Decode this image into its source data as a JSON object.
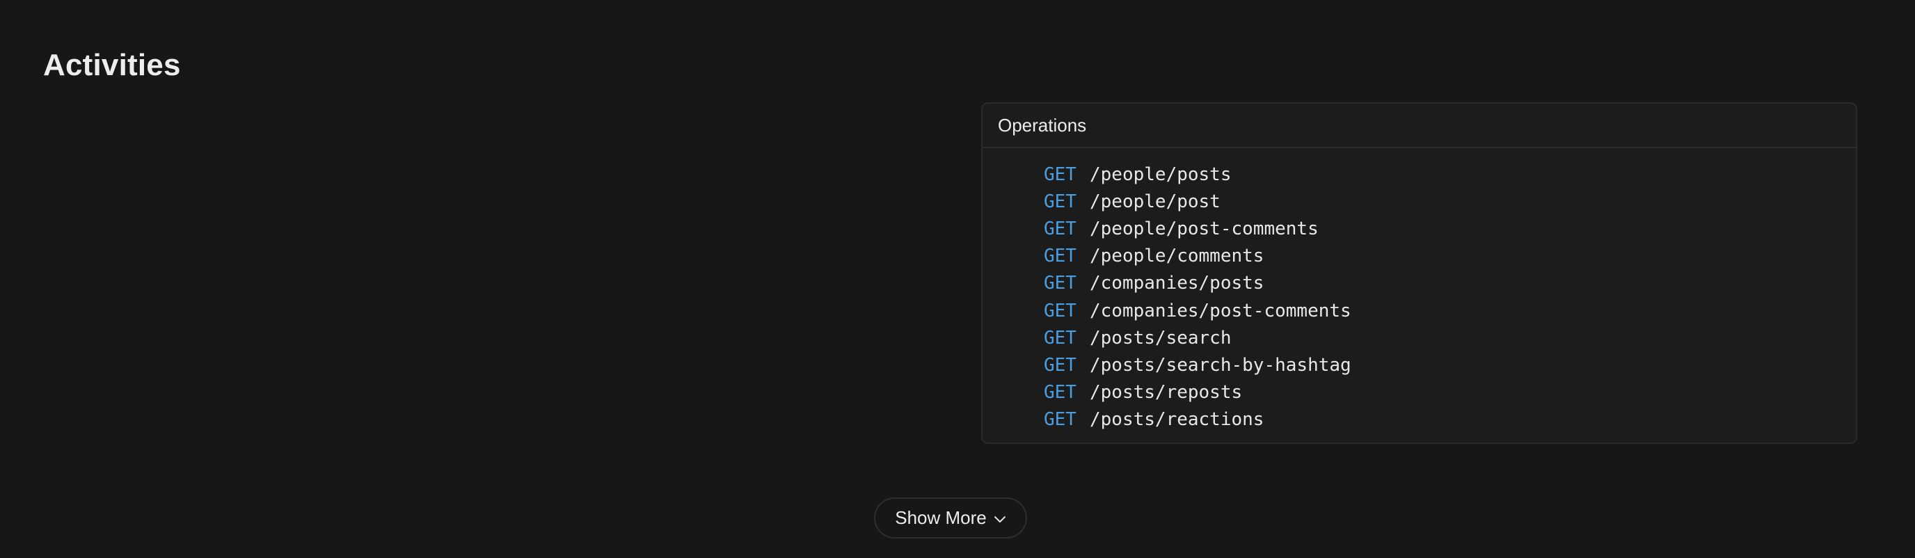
{
  "page": {
    "title": "Activities"
  },
  "operations": {
    "title": "Operations",
    "items": [
      {
        "method": "GET",
        "path": "/people/posts"
      },
      {
        "method": "GET",
        "path": "/people/post"
      },
      {
        "method": "GET",
        "path": "/people/post-comments"
      },
      {
        "method": "GET",
        "path": "/people/comments"
      },
      {
        "method": "GET",
        "path": "/companies/posts"
      },
      {
        "method": "GET",
        "path": "/companies/post-comments"
      },
      {
        "method": "GET",
        "path": "/posts/search"
      },
      {
        "method": "GET",
        "path": "/posts/search-by-hashtag"
      },
      {
        "method": "GET",
        "path": "/posts/reposts"
      },
      {
        "method": "GET",
        "path": "/posts/reactions"
      }
    ]
  },
  "show_more": {
    "label": "Show More",
    "icon": "chevron-down-icon"
  },
  "colors": {
    "background": "#171717",
    "panel": "#1c1c1c",
    "border": "#2b2b2b",
    "method": "#4b9ee0",
    "text": "#ededed"
  }
}
